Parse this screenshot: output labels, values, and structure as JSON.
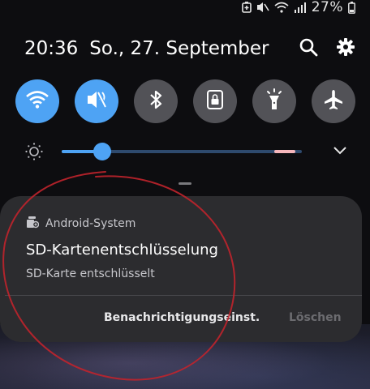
{
  "status_bar": {
    "battery_percent": "27%",
    "icons": [
      "battery-saver-icon",
      "mute-icon",
      "wifi-icon",
      "signal-icon",
      "battery-icon"
    ]
  },
  "header": {
    "time": "20:36",
    "date": "So., 27. September",
    "search_icon": "search-icon",
    "settings_icon": "gear-icon"
  },
  "quick_tiles": [
    {
      "name": "wifi",
      "icon": "wifi-icon",
      "active": true
    },
    {
      "name": "sound",
      "icon": "mute-icon",
      "active": true
    },
    {
      "name": "bluetooth",
      "icon": "bluetooth-icon",
      "active": false
    },
    {
      "name": "rotation-lock",
      "icon": "lock-icon",
      "active": false
    },
    {
      "name": "flashlight",
      "icon": "flashlight-icon",
      "active": false
    },
    {
      "name": "airplane-mode",
      "icon": "airplane-icon",
      "active": false
    }
  ],
  "brightness": {
    "level": 0.17,
    "adaptive_mark": 0.93
  },
  "notification": {
    "app_name": "Android-System",
    "title": "SD-Kartenentschlüsselung",
    "text": "SD-Karte entschlüsselt",
    "action_settings": "Benachrichtigungseinst.",
    "action_clear": "Löschen"
  },
  "colors": {
    "accent": "#4ea3f4",
    "tile_inactive": "#525257",
    "card_bg": "#2c2c2f",
    "annotation": "#c0242c"
  }
}
